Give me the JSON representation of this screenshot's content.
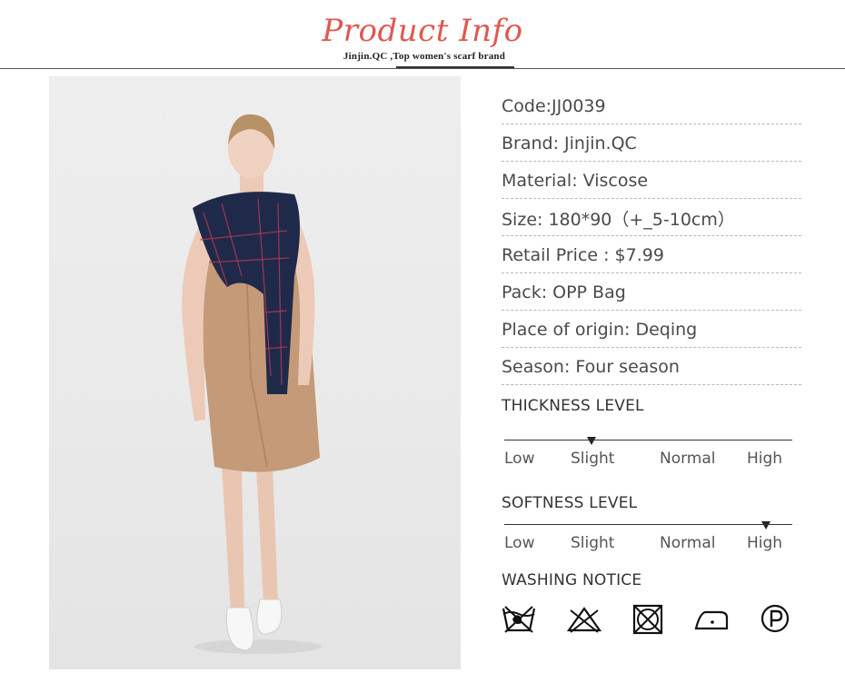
{
  "header": {
    "title": "Product Info",
    "subtitle": "Jinjin.QC ,Top women's scarf brand"
  },
  "specs": [
    "Code:JJ0039",
    "Brand: Jinjin.QC",
    "Material: Viscose",
    "Size: 180*90（+_5-10cm）",
    "Retail Price : $7.99",
    "Pack: OPP Bag",
    "Place of origin: Deqing",
    "Season:  Four season"
  ],
  "thickness": {
    "title": "THICKNESS LEVEL",
    "labels": [
      "Low",
      "Slight",
      "Normal",
      "High"
    ],
    "selected": "Slight"
  },
  "softness": {
    "title": "SOFTNESS LEVEL",
    "labels": [
      "Low",
      "Slight",
      "Normal",
      "High"
    ],
    "selected": "High"
  },
  "washing": {
    "title": "WASHING NOTICE",
    "icons": [
      "hand-wash-icon",
      "do-not-bleach-icon",
      "do-not-tumble-dry-icon",
      "iron-low-heat-icon",
      "dry-clean-p-icon"
    ]
  },
  "colors": {
    "title": "#e0584f",
    "scarf": "#1f2a4a",
    "dress": "#c49a78"
  }
}
